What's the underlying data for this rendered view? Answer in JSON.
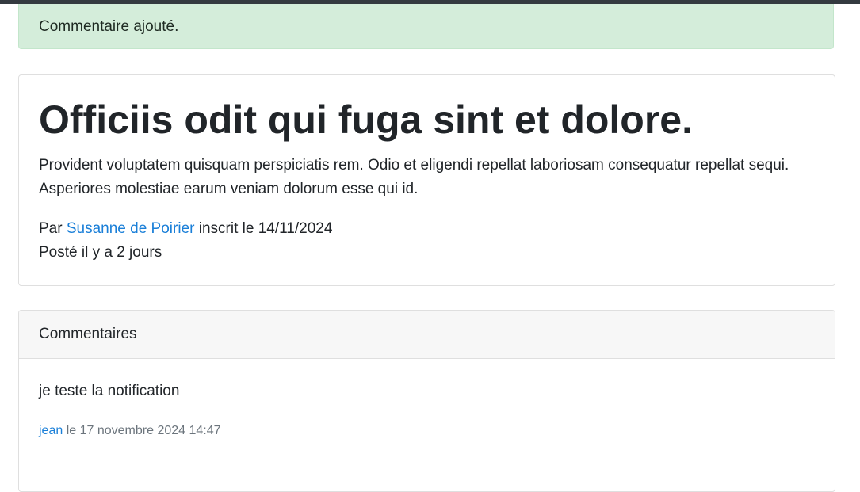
{
  "alert": {
    "message": "Commentaire ajouté."
  },
  "post": {
    "title": "Officiis odit qui fuga sint et dolore.",
    "body": "Provident voluptatem quisquam perspiciatis rem. Odio et eligendi repellat laboriosam consequatur repellat sequi. Asperiores molestiae earum veniam dolorum esse qui id.",
    "by_label": "Par",
    "author": "Susanne de Poirier",
    "registered_text": "inscrit le 14/11/2024",
    "posted_text": "Posté il y a 2 jours"
  },
  "comments": {
    "header": "Commentaires",
    "items": [
      {
        "text": "je teste la notification",
        "author": "jean",
        "date": "le 17 novembre 2024 14:47"
      }
    ]
  },
  "colors": {
    "alert_bg": "#d4edda",
    "link": "#1a7fd8",
    "topbar": "#343a40"
  }
}
